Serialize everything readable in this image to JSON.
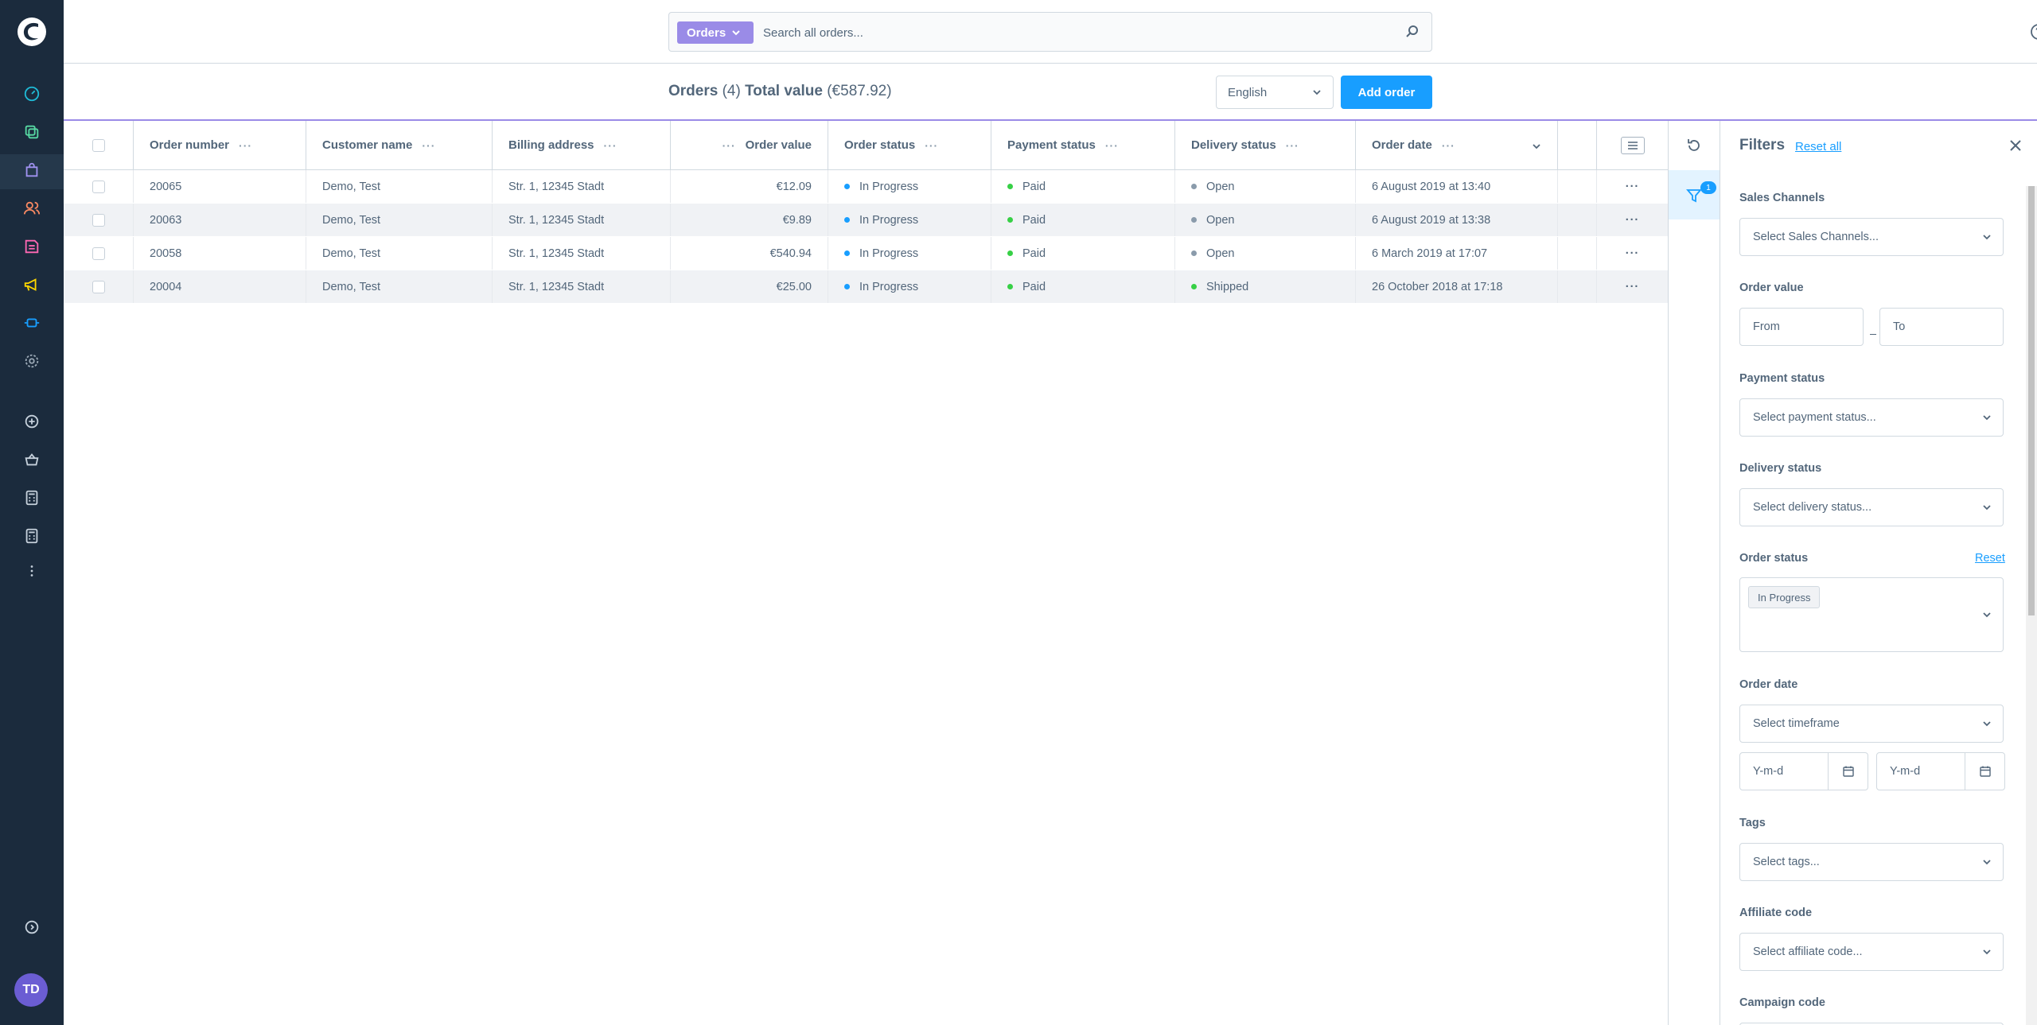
{
  "search": {
    "type_label": "Orders",
    "placeholder": "Search all orders..."
  },
  "smartbar": {
    "title": "Orders",
    "count": "(4)",
    "total_label": "Total value",
    "total_value": "(€587.92)",
    "language": "English",
    "add_label": "Add order"
  },
  "grid": {
    "columns": [
      "Order number",
      "Customer name",
      "Billing address",
      "Order value",
      "Order status",
      "Payment status",
      "Delivery status",
      "Order date"
    ],
    "rows": [
      {
        "number": "20065",
        "customer": "Demo, Test",
        "address": "Str. 1, 12345 Stadt",
        "value": "€12.09",
        "order_status": "In Progress",
        "payment": "Paid",
        "delivery": "Open",
        "date": "6 August 2019 at 13:40"
      },
      {
        "number": "20063",
        "customer": "Demo, Test",
        "address": "Str. 1, 12345 Stadt",
        "value": "€9.89",
        "order_status": "In Progress",
        "payment": "Paid",
        "delivery": "Open",
        "date": "6 August 2019 at 13:38"
      },
      {
        "number": "20058",
        "customer": "Demo, Test",
        "address": "Str. 1, 12345 Stadt",
        "value": "€540.94",
        "order_status": "In Progress",
        "payment": "Paid",
        "delivery": "Open",
        "date": "6 March 2019 at 17:07"
      },
      {
        "number": "20004",
        "customer": "Demo, Test",
        "address": "Str. 1, 12345 Stadt",
        "value": "€25.00",
        "order_status": "In Progress",
        "payment": "Paid",
        "delivery": "Shipped",
        "date": "26 October 2018 at 17:18"
      }
    ],
    "status_colors": {
      "in_progress": "#189eff",
      "paid": "#37d046",
      "open": "#8a9bab",
      "shipped": "#37d046"
    }
  },
  "sidebar": {
    "filter_badge": "1"
  },
  "filters": {
    "title": "Filters",
    "reset_all": "Reset all",
    "sales_channels_label": "Sales Channels",
    "sales_channels_placeholder": "Select Sales Channels...",
    "order_value_label": "Order value",
    "from_placeholder": "From",
    "to_placeholder": "To",
    "payment_status_label": "Payment status",
    "payment_status_placeholder": "Select payment status...",
    "delivery_status_label": "Delivery status",
    "delivery_status_placeholder": "Select delivery status...",
    "order_status_label": "Order status",
    "order_status_reset": "Reset",
    "order_status_selected": "In Progress",
    "order_date_label": "Order date",
    "order_date_placeholder": "Select timeframe",
    "date_from_placeholder": "Y-m-d",
    "date_to_placeholder": "Y-m-d",
    "tags_label": "Tags",
    "tags_placeholder": "Select tags...",
    "affiliate_label": "Affiliate code",
    "affiliate_placeholder": "Select affiliate code...",
    "campaign_label": "Campaign code"
  },
  "user": {
    "initials": "TD"
  },
  "colors": {
    "nav_bg": "#1b2b3d",
    "accent": "#189eff",
    "orders_purple": "#9a8be7"
  }
}
